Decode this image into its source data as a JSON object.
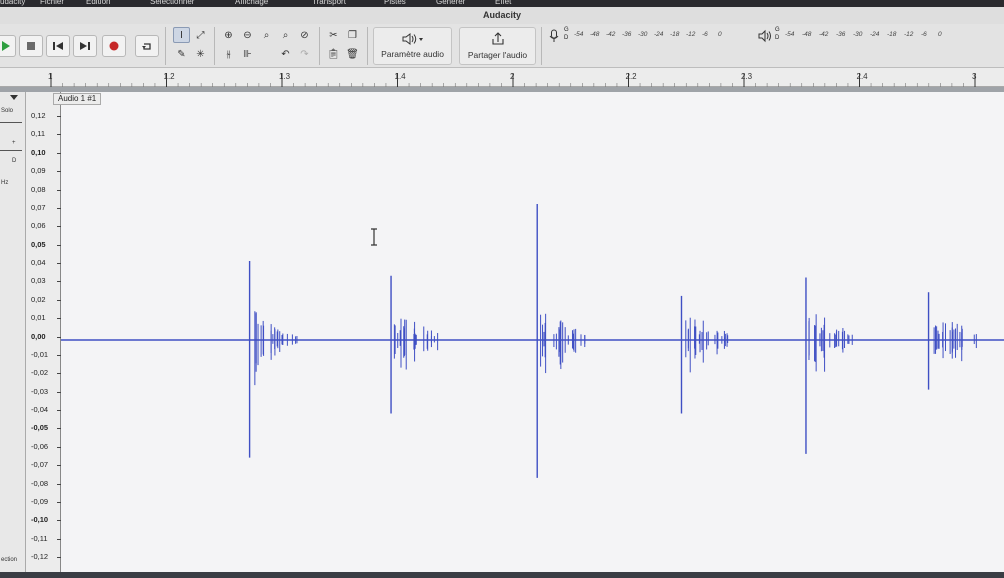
{
  "menubar": {
    "items": [
      "udacity",
      "Fichier",
      "Édition",
      "Sélectionner",
      "Affichage",
      "Transport",
      "Pistes",
      "Générer",
      "Effet"
    ]
  },
  "window": {
    "title": "Audacity"
  },
  "toolbar": {
    "transport": [
      {
        "name": "play-button",
        "icon": "play-icon",
        "color": "#2e9e3f"
      },
      {
        "name": "stop-button",
        "icon": "stop-icon"
      },
      {
        "name": "skip-start-button",
        "icon": "skip-start-icon"
      },
      {
        "name": "skip-end-button",
        "icon": "skip-end-icon"
      },
      {
        "name": "record-button",
        "icon": "record-icon",
        "color": "#c62828"
      },
      {
        "name": "loop-button",
        "icon": "loop-icon"
      }
    ],
    "audio_setup": {
      "label": "Paramètre audio"
    },
    "share_audio": {
      "label": "Partager l'audio"
    },
    "record_meter": {
      "channels": [
        "G",
        "D"
      ],
      "ticks": [
        "-54",
        "-48",
        "-42",
        "-36",
        "-30",
        "-24",
        "-18",
        "-12",
        "-6",
        "0"
      ]
    },
    "play_meter": {
      "channels": [
        "G",
        "D"
      ],
      "ticks": [
        "-54",
        "-48",
        "-42",
        "-36",
        "-30",
        "-24",
        "-18",
        "-12",
        "-6",
        "0"
      ]
    }
  },
  "timeline": {
    "labels": [
      "1",
      "1.2",
      "1.3",
      "1.4",
      "2",
      "2.2",
      "2.3",
      "2.4",
      "3"
    ]
  },
  "track": {
    "name": "Audio 1 #1",
    "controls": {
      "solo": "Solo",
      "rate": "Hz",
      "select": "ection",
      "gain_marks": [
        "+",
        "D"
      ]
    },
    "scale": [
      "0,12",
      "0,11",
      "0,10",
      "0,09",
      "0,08",
      "0,07",
      "0,06",
      "0,05",
      "0,04",
      "0,03",
      "0,02",
      "0,01",
      "0,00",
      "-0,01",
      "-0,02",
      "-0,03",
      "-0,04",
      "-0,05",
      "-0,06",
      "-0,07",
      "-0,08",
      "-0,09",
      "-0,10",
      "-0,11",
      "-0,12"
    ],
    "waveform_color": "#3f4fc4",
    "events": [
      {
        "t": 0.2,
        "peak": 0.043,
        "trough": -0.064
      },
      {
        "t": 0.35,
        "peak": 0.035,
        "trough": -0.04
      },
      {
        "t": 0.505,
        "peak": 0.074,
        "trough": -0.075
      },
      {
        "t": 0.658,
        "peak": 0.024,
        "trough": -0.04
      },
      {
        "t": 0.79,
        "peak": 0.034,
        "trough": -0.062
      },
      {
        "t": 0.92,
        "peak": 0.026,
        "trough": -0.027
      }
    ]
  }
}
